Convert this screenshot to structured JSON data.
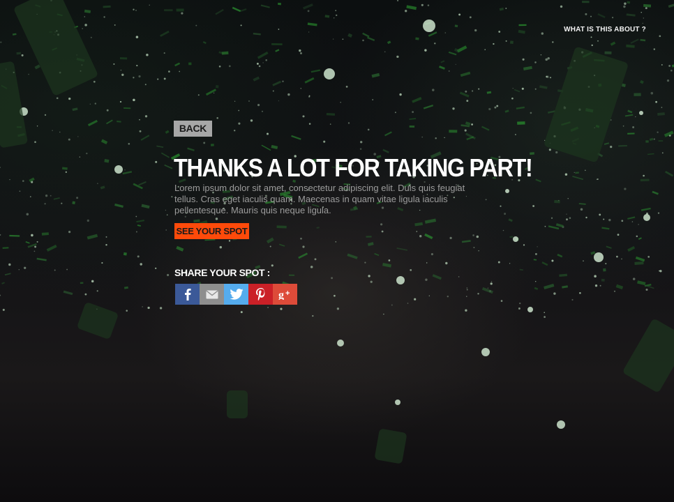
{
  "header": {
    "about_link": "WHAT IS THIS ABOUT ?"
  },
  "main": {
    "back_label": "BACK",
    "title": "THANKS A LOT FOR TAKING PART!",
    "body": "Lorem ipsum dolor sit amet, consectetur adipiscing elit. Duis quis feugiat tellus. Cras eget iaculis quam. Maecenas in quam vitae ligula iaculis pellentesque. Mauris quis neque ligula.",
    "see_spot_label": "SEE YOUR SPOT",
    "share_label": "SHARE YOUR SPOT :"
  },
  "share": [
    {
      "name": "facebook-icon",
      "color": "#3b5998"
    },
    {
      "name": "email-icon",
      "color": "#8e8e8e"
    },
    {
      "name": "twitter-icon",
      "color": "#55acee"
    },
    {
      "name": "pinterest-icon",
      "color": "#cb2027"
    },
    {
      "name": "google-plus-icon",
      "color": "#dd4b39"
    }
  ],
  "colors": {
    "accent": "#ff4a0a",
    "back_button": "#a7a7a7"
  }
}
